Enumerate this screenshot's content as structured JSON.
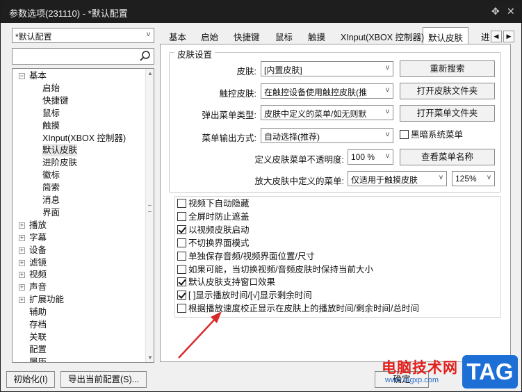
{
  "window": {
    "title": "参数选项(231110) - *默认配置",
    "pin_glyph": "✥",
    "close_glyph": "✕"
  },
  "profile_combo": {
    "value": "*默认配置"
  },
  "search": {
    "placeholder": "",
    "icon": "search-icon"
  },
  "tree": [
    {
      "label": "基本",
      "level": 0,
      "expander": "−"
    },
    {
      "label": "启始",
      "level": 1
    },
    {
      "label": "快捷键",
      "level": 1
    },
    {
      "label": "鼠标",
      "level": 1
    },
    {
      "label": "触摸",
      "level": 1
    },
    {
      "label": "XInput(XBOX 控制器)",
      "level": 1
    },
    {
      "label": "默认皮肤",
      "level": 1,
      "selected": true
    },
    {
      "label": "进阶皮肤",
      "level": 1
    },
    {
      "label": "徽标",
      "level": 1
    },
    {
      "label": "简索",
      "level": 1
    },
    {
      "label": "消息",
      "level": 1
    },
    {
      "label": "界面",
      "level": 1
    },
    {
      "label": "播放",
      "level": 0,
      "expander": "+"
    },
    {
      "label": "字幕",
      "level": 0,
      "expander": "+"
    },
    {
      "label": "设备",
      "level": 0,
      "expander": "+"
    },
    {
      "label": "滤镜",
      "level": 0,
      "expander": "+"
    },
    {
      "label": "视频",
      "level": 0,
      "expander": "+"
    },
    {
      "label": "声音",
      "level": 0,
      "expander": "+"
    },
    {
      "label": "扩展功能",
      "level": 0,
      "expander": "+"
    },
    {
      "label": "辅助",
      "level": 0
    },
    {
      "label": "存档",
      "level": 0
    },
    {
      "label": "关联",
      "level": 0
    },
    {
      "label": "配置",
      "level": 0
    },
    {
      "label": "履历",
      "level": 0
    }
  ],
  "tabs": [
    {
      "label": "基本"
    },
    {
      "label": "启始"
    },
    {
      "label": "快捷键"
    },
    {
      "label": "鼠标"
    },
    {
      "label": "触摸"
    },
    {
      "label": "XInput(XBOX 控制器)"
    },
    {
      "label": "默认皮肤",
      "active": true
    },
    {
      "label": "进"
    }
  ],
  "skin": {
    "group_title": "皮肤设置",
    "skin_label": "皮肤:",
    "skin_value": "[内置皮肤]",
    "rescan_button": "重新搜索",
    "touch_skin_label": "触控皮肤:",
    "touch_skin_value": "在触控设备使用触控皮肤(推",
    "open_skin_folder_button": "打开皮肤文件夹",
    "popup_menu_type_label": "弹出菜单类型:",
    "popup_menu_type_value": "皮肤中定义的菜单/如无则默",
    "open_menu_folder_button": "打开菜单文件夹",
    "menu_output_label": "菜单输出方式:",
    "menu_output_value": "自动选择(推荐)",
    "dark_menu_label": "黑暗系统菜单",
    "dark_menu_checked": false,
    "menu_opacity_label": "定义皮肤菜单不透明度:",
    "menu_opacity_value": "100 %",
    "view_menu_name_button": "查看菜单名称",
    "enlarge_menu_label": "放大皮肤中定义的菜单:",
    "enlarge_menu_value": "仅适用于触摸皮肤",
    "enlarge_scale_value": "125%"
  },
  "options": [
    {
      "label": "视频下自动隐藏",
      "checked": false
    },
    {
      "label": "全屏时防止遮盖",
      "checked": false
    },
    {
      "label": "以视频皮肤启动",
      "checked": true
    },
    {
      "label": "不切换界面模式",
      "checked": false
    },
    {
      "label": "单独保存音频/视频界面位置/尺寸",
      "checked": false
    },
    {
      "label": "如果可能，当切换视频/音频皮肤时保持当前大小",
      "checked": false
    },
    {
      "label": "默认皮肤支持窗口效果",
      "checked": true
    },
    {
      "label": "[ ]显示播放时间/[√]显示剩余时间",
      "checked": true
    },
    {
      "label": "根据播放速度校正显示在皮肤上的播放时间/剩余时间/总时间",
      "checked": false
    }
  ],
  "footer": {
    "init_button": "初始化(I)",
    "export_button": "导出当前配置(S)...",
    "confirm_button": "确定"
  },
  "watermark": {
    "text": "电脑技术网",
    "url": "www.tagxp.com",
    "tag": "TAG"
  },
  "colors": {
    "titlebar": "#1e1e1e",
    "annotation_arrow": "#d92a2a",
    "watermark_red": "#e0201c",
    "watermark_blue": "#1d6fd6"
  }
}
